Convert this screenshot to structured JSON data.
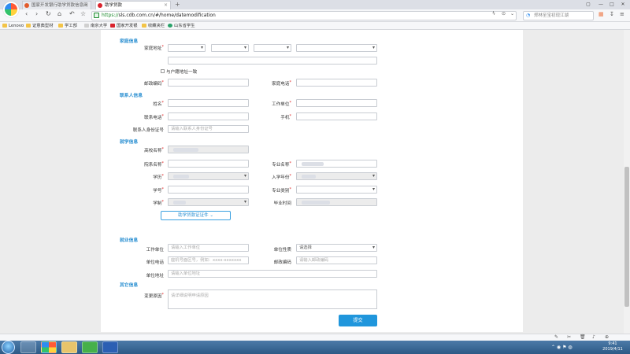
{
  "browser": {
    "tabs": [
      {
        "label": "国家开发银行助学贷款信息网"
      },
      {
        "label": "助学贷款"
      }
    ],
    "url_scheme": "https://",
    "url_rest": "sls.cdb.com.cn/#/home/datemodification",
    "search_placeholder": "郑林至宝初现江湖",
    "bookmarks": [
      "Lenovo",
      "证意典型材",
      "学工部",
      "南京大学",
      "国家开发银",
      "收藏夹栏",
      "山东省学生"
    ]
  },
  "form": {
    "family_section": "家庭信息",
    "home_address": "家庭地址",
    "same_as_hukou": "与户籍地址一致",
    "postcode": "邮政编码",
    "home_phone": "家庭电话",
    "contact_section": "联系人信息",
    "name": "姓名",
    "work_unit": "工作单位",
    "contact_phone": "联系电话",
    "mobile": "手机",
    "contact_id": "联系人身份证号",
    "contact_id_ph": "请输入联系人身份证号",
    "study_section": "就学信息",
    "school_name": "高校名称",
    "faculty_name": "院系名称",
    "major_name": "专业名称",
    "degree": "学历",
    "enroll_year": "入学年份",
    "student_id": "学号",
    "major_type": "专业类别",
    "length": "学制",
    "grad_time": "毕业时间",
    "upload_button": "助学贷款证证件",
    "job_section": "就业信息",
    "job_unit": "工作单位",
    "job_unit_ph": "请输入工作单位",
    "unit_nature": "单位性质",
    "unit_nature_ph": "请选择",
    "unit_phone": "单位电话",
    "unit_phone_ph": "座机号面区号，例如：xxxx-xxxxxxx",
    "unit_postcode": "邮政编码",
    "unit_postcode_ph": "请输入邮政编码",
    "unit_address": "单位地址",
    "unit_address_ph": "请输入单位地址",
    "change_section": "其它信息",
    "change_reason": "变更原因",
    "change_reason_ph": "请详细说明申请原因",
    "submit": "提交"
  },
  "taskbar": {
    "time": "9:41",
    "date": "2019/4/11"
  }
}
